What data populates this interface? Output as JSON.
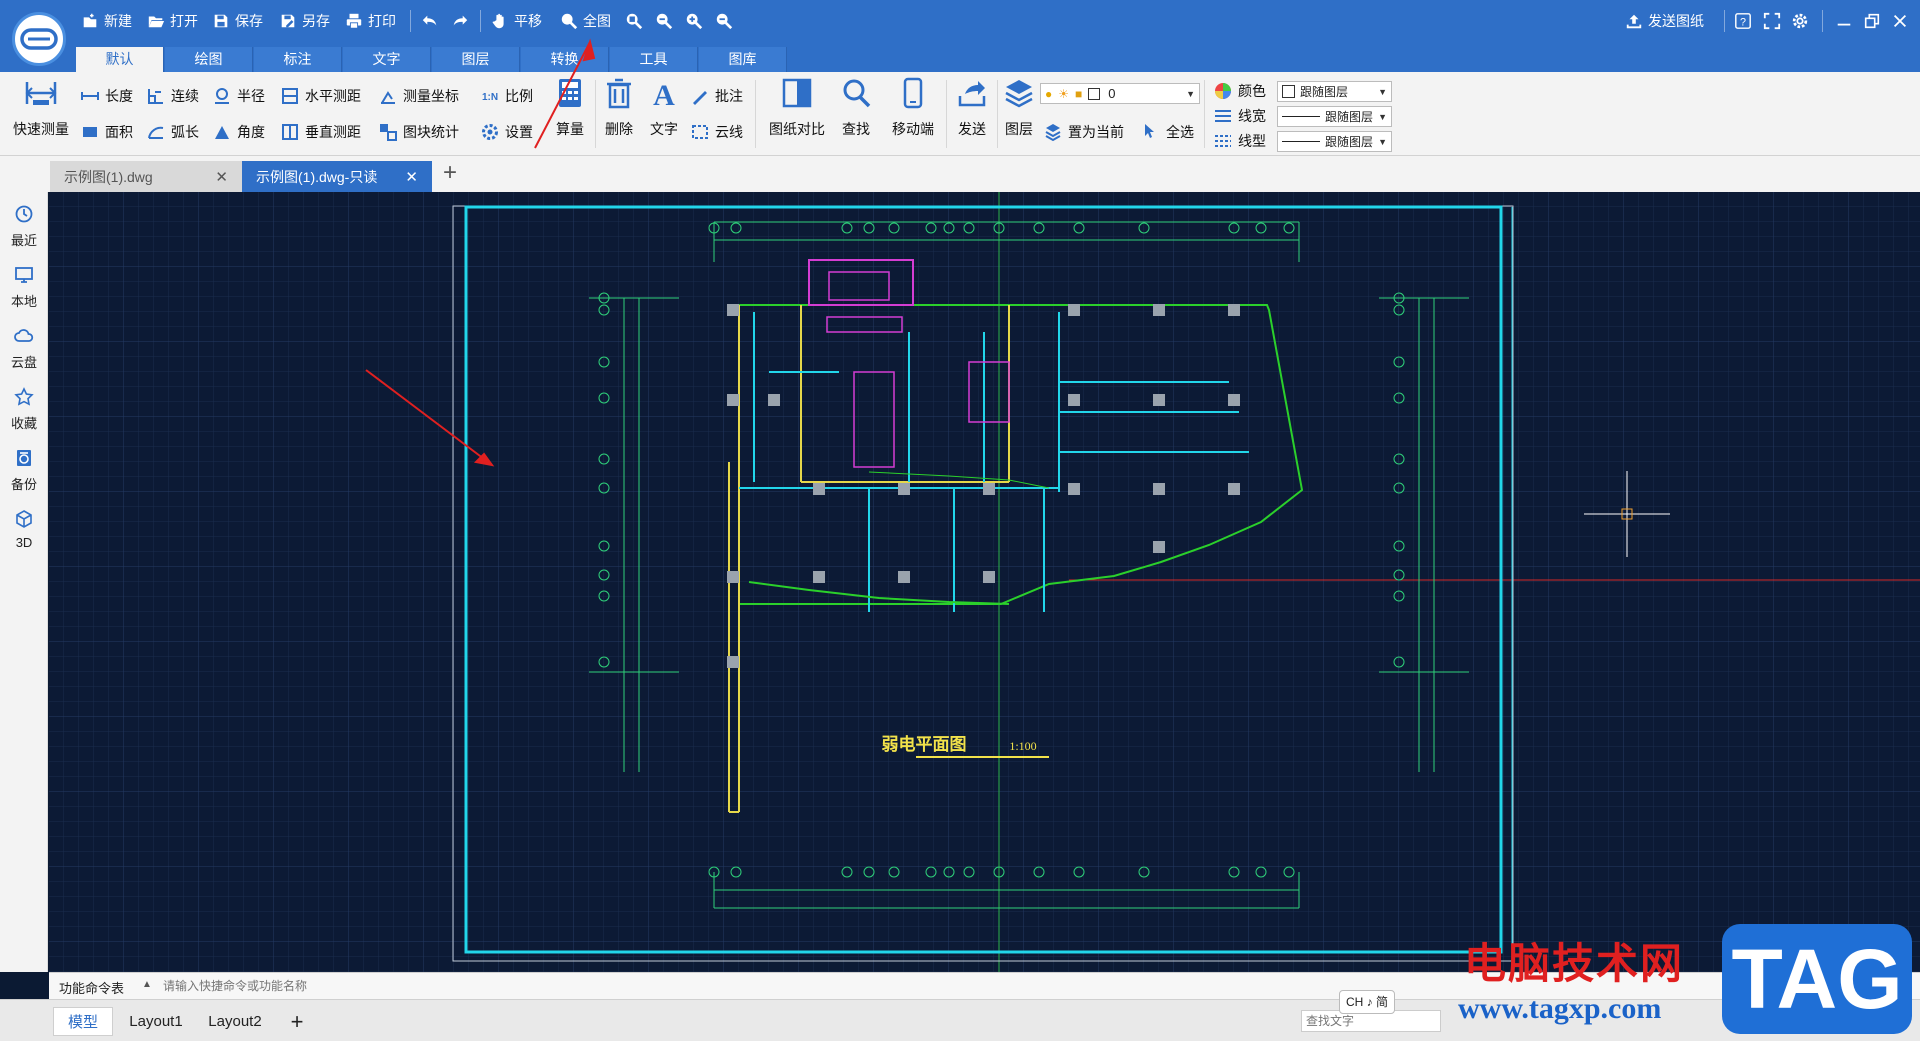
{
  "app": {
    "quick_access": [
      {
        "label": "新建",
        "icon": "new-file-icon"
      },
      {
        "label": "打开",
        "icon": "folder-open-icon"
      },
      {
        "label": "保存",
        "icon": "save-icon"
      },
      {
        "label": "另存",
        "icon": "save-as-icon"
      },
      {
        "label": "打印",
        "icon": "print-icon"
      }
    ],
    "pan_label": "平移",
    "fit_label": "全图",
    "send_drawing": "发送图纸",
    "window_controls": [
      "minimize",
      "restore",
      "close"
    ]
  },
  "ribbon_tabs": [
    "默认",
    "绘图",
    "标注",
    "文字",
    "图层",
    "转换",
    "工具",
    "图库"
  ],
  "active_ribbon_tab": "默认",
  "ribbon": {
    "quick_measure": "快速测量",
    "measure_col1": [
      "长度",
      "面积"
    ],
    "measure_col2": [
      "连续",
      "弧长"
    ],
    "measure_col3": [
      "半径",
      "角度"
    ],
    "measure_col4": [
      "水平测距",
      "垂直测距"
    ],
    "measure_col5": [
      "测量坐标",
      "图块统计"
    ],
    "measure_col6": [
      "比例",
      "设置"
    ],
    "calc": "算量",
    "delete": "删除",
    "text": "文字",
    "annotate": [
      "批注",
      "云线"
    ],
    "compare": "图纸对比",
    "find": "查找",
    "mobile": "移动端",
    "send": "发送",
    "layer": "图层",
    "set_current": "置为当前",
    "select_all": "全选",
    "layer_value": "0",
    "color_label": "颜色",
    "color_value": "跟随图层",
    "lineweight_label": "线宽",
    "lineweight_value": "跟随图层",
    "linetype_label": "线型",
    "linetype_value": "跟随图层"
  },
  "doc_tabs": [
    {
      "label": "示例图(1).dwg",
      "active": false
    },
    {
      "label": "示例图(1).dwg-只读",
      "active": true
    }
  ],
  "sidebar": [
    {
      "label": "最近",
      "icon": "clock-icon"
    },
    {
      "label": "本地",
      "icon": "monitor-icon"
    },
    {
      "label": "云盘",
      "icon": "cloud-icon"
    },
    {
      "label": "收藏",
      "icon": "star-icon"
    },
    {
      "label": "备份",
      "icon": "backup-icon"
    },
    {
      "label": "3D",
      "icon": "cube-icon"
    }
  ],
  "drawing": {
    "title": "弱电平面图",
    "scale": "1:100"
  },
  "command_bar": {
    "label": "功能命令表",
    "placeholder": "请输入快捷命令或功能名称"
  },
  "layout_tabs": [
    "模型",
    "Layout1",
    "Layout2"
  ],
  "active_layout": "模型",
  "find_placeholder": "查找文字",
  "ime_indicator": "CH ♪ 简",
  "watermark": {
    "cn_text": "电脑技术网",
    "url": "www.tagxp.com",
    "badge": "TAG"
  }
}
